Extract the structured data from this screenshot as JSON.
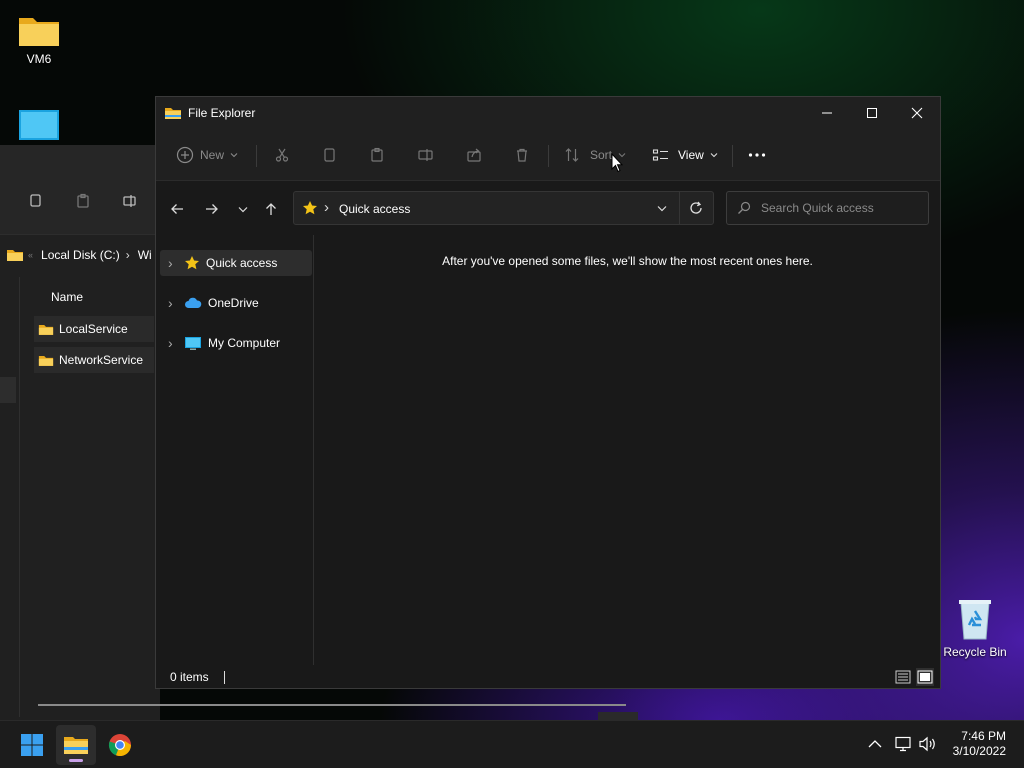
{
  "desktop": {
    "icons": [
      {
        "label": "VM6",
        "icon": "folder-icon"
      },
      {
        "label": "",
        "icon": "monitor-icon"
      },
      {
        "label": "Recycle Bin",
        "icon": "recycle-bin-icon"
      }
    ]
  },
  "background_window": {
    "breadcrumb": [
      "Local Disk (C:)",
      "Wi"
    ],
    "column_header": "Name",
    "rows": [
      "LocalService",
      "NetworkService"
    ]
  },
  "window": {
    "title": "File Explorer",
    "commands": {
      "new_label": "New",
      "sort_label": "Sort",
      "view_label": "View"
    },
    "address": {
      "location": "Quick access"
    },
    "search": {
      "placeholder": "Search Quick access"
    },
    "nav_pane": [
      {
        "label": "Quick access",
        "icon": "star-icon",
        "selected": true
      },
      {
        "label": "OneDrive",
        "icon": "cloud-icon",
        "selected": false
      },
      {
        "label": "My Computer",
        "icon": "monitor-icon",
        "selected": false
      }
    ],
    "empty_message": "After you've opened some files, we'll show the most recent ones here.",
    "status": {
      "item_count": "0 items"
    }
  },
  "taskbar": {
    "apps": [
      "start-icon",
      "file-explorer-icon",
      "chrome-icon"
    ],
    "clock": {
      "time": "7:46 PM",
      "date": "3/10/2022"
    }
  },
  "colors": {
    "folder": "#f5c542",
    "accent_blue": "#3aa0f0",
    "star": "#f3c317",
    "window_bg": "#191919"
  }
}
